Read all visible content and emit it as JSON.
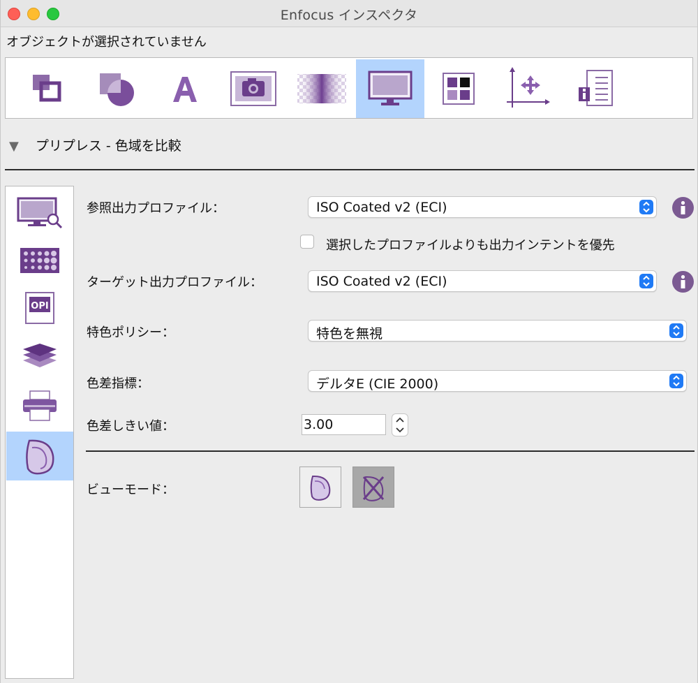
{
  "window": {
    "title": "Enfocus インスペクタ",
    "status": "オブジェクトが選択されていません"
  },
  "toolbar": {
    "items": [
      {
        "icon": "object-arrange-icon"
      },
      {
        "icon": "shape-fill-icon"
      },
      {
        "icon": "text-icon"
      },
      {
        "icon": "image-icon"
      },
      {
        "icon": "transparency-icon"
      },
      {
        "icon": "monitor-icon",
        "selected": true
      },
      {
        "icon": "color-swatch-icon"
      },
      {
        "icon": "position-axes-icon"
      },
      {
        "icon": "document-info-icon"
      }
    ]
  },
  "section": {
    "title": "プリプレス - 色域を比較"
  },
  "sidebar": {
    "items": [
      {
        "icon": "monitor-magnify-icon"
      },
      {
        "icon": "halftone-grid-icon"
      },
      {
        "icon": "opi-icon",
        "text": "OPI"
      },
      {
        "icon": "layers-icon"
      },
      {
        "icon": "printer-icon"
      },
      {
        "icon": "gamut-icon",
        "selected": true
      }
    ]
  },
  "form": {
    "reference_profile": {
      "label": "参照出力プロファイル：",
      "value": "ISO Coated v2 (ECI)"
    },
    "prefer_intent": {
      "label": "選択したプロファイルよりも出力インテントを優先",
      "checked": false
    },
    "target_profile": {
      "label": "ターゲット出力プロファイル：",
      "value": "ISO Coated v2 (ECI)"
    },
    "spot_policy": {
      "label": "特色ポリシー：",
      "value": "特色を無視"
    },
    "delta_metric": {
      "label": "色差指標：",
      "value": "デルタE (CIE 2000)"
    },
    "delta_threshold": {
      "label": "色差しきい値：",
      "value": "3.00"
    },
    "view_mode": {
      "label": "ビューモード："
    }
  },
  "colors": {
    "accent_purple": "#7b4fa0",
    "selection_blue": "#b3d4fd",
    "popup_blue": "#1f7af5"
  }
}
